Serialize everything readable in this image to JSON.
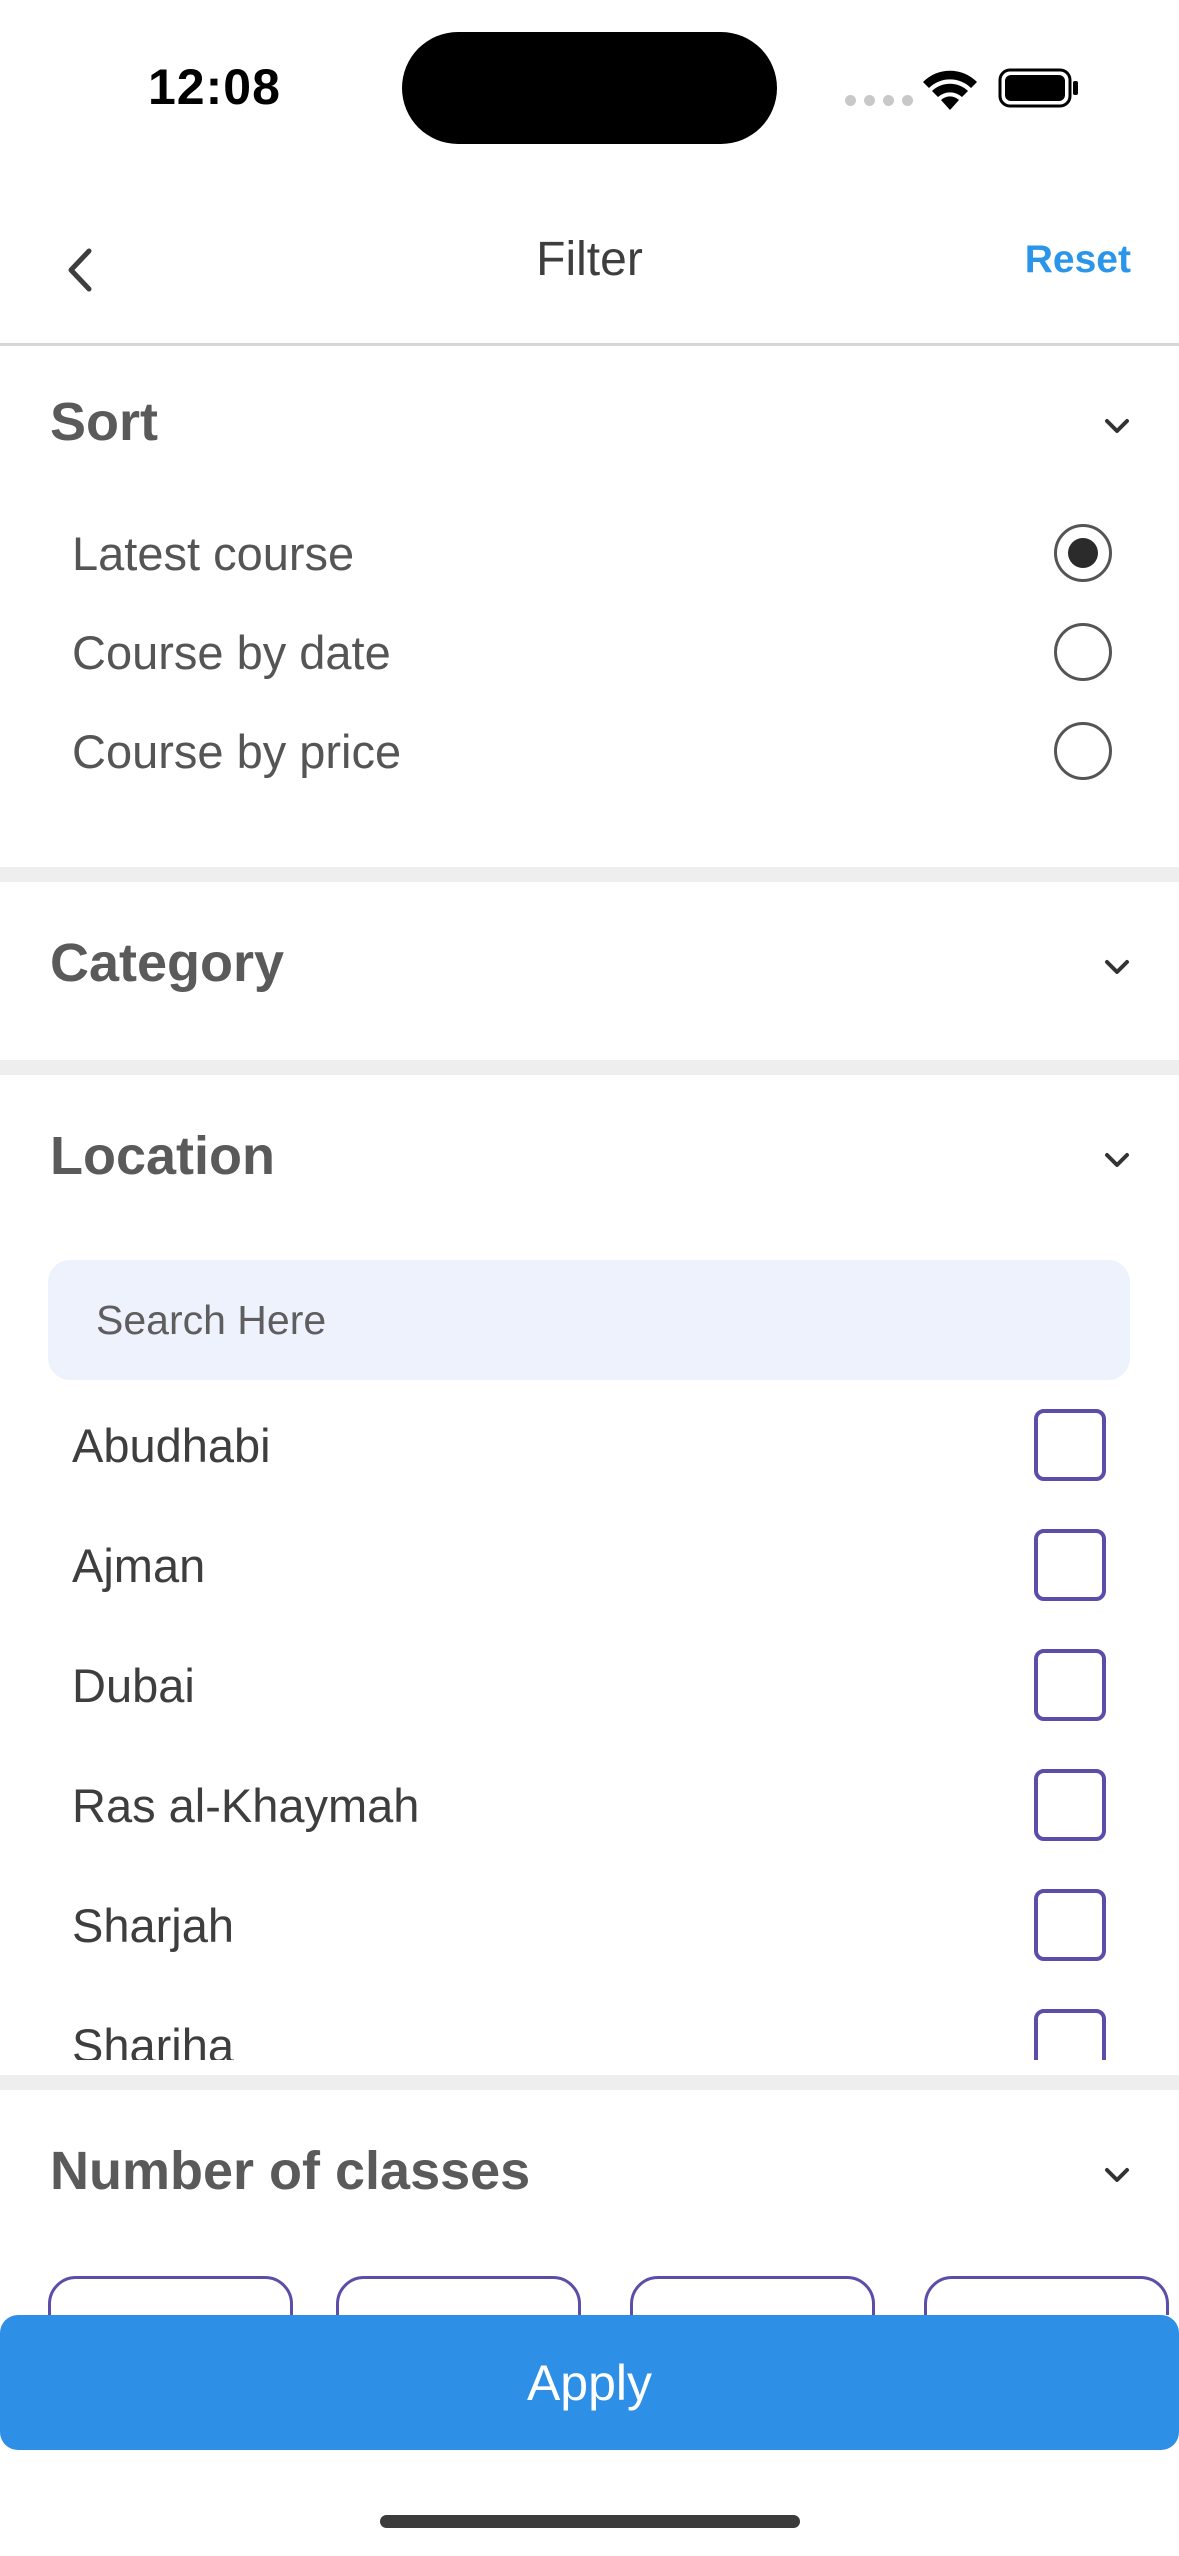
{
  "status_bar": {
    "time": "12:08"
  },
  "header": {
    "title": "Filter",
    "reset_label": "Reset",
    "back_icon": "chevron-left-icon"
  },
  "sort": {
    "title": "Sort",
    "options": [
      {
        "label": "Latest course",
        "selected": true
      },
      {
        "label": "Course by date",
        "selected": false
      },
      {
        "label": "Course by price",
        "selected": false
      }
    ]
  },
  "category": {
    "title": "Category"
  },
  "location": {
    "title": "Location",
    "search_placeholder": "Search Here",
    "items": [
      {
        "label": "Abudhabi",
        "checked": false
      },
      {
        "label": "Ajman",
        "checked": false
      },
      {
        "label": "Dubai",
        "checked": false
      },
      {
        "label": "Ras al-Khaymah",
        "checked": false
      },
      {
        "label": "Sharjah",
        "checked": false
      },
      {
        "label": "Shariha",
        "checked": false
      }
    ]
  },
  "number_of_classes": {
    "title": "Number of classes"
  },
  "apply_label": "Apply",
  "colors": {
    "accent": "#2b95e9",
    "apply_bg": "#2d8fe6",
    "checkbox_border": "#5a4ea8",
    "search_bg": "#eef2fd"
  }
}
